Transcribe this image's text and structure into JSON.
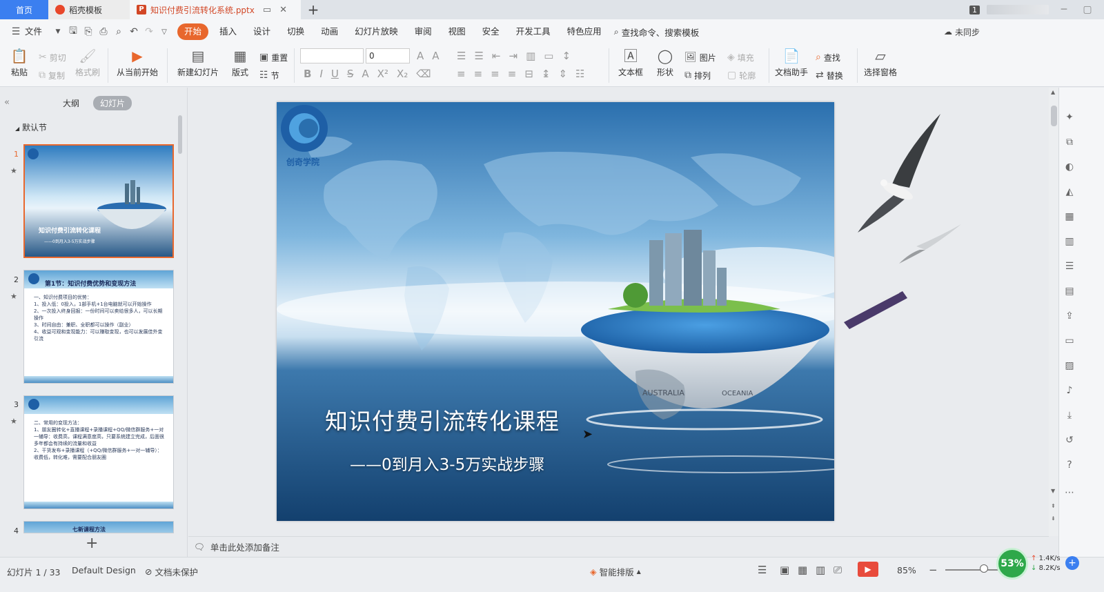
{
  "tabs": {
    "home": "首页",
    "template": "稻壳模板",
    "active_file": "知识付费引流转化系统.pptx",
    "page_badge": "1"
  },
  "menu": {
    "file": "文件",
    "items": [
      "开始",
      "插入",
      "设计",
      "切换",
      "动画",
      "幻灯片放映",
      "审阅",
      "视图",
      "安全",
      "开发工具",
      "特色应用"
    ],
    "search": "查找命令、搜索模板",
    "sync": "未同步"
  },
  "ribbon": {
    "paste": "粘贴",
    "cut": "剪切",
    "copy": "复制",
    "format_painter": "格式刷",
    "from_current": "从当前开始",
    "new_slide": "新建幻灯片",
    "layout": "版式",
    "reset": "重置",
    "section": "节",
    "font_size": "0",
    "text_box": "文本框",
    "shape": "形状",
    "picture": "图片",
    "arrange": "排列",
    "fill": "填充",
    "outline": "轮廓",
    "doc_assistant": "文档助手",
    "find": "查找",
    "replace": "替换",
    "selection_pane": "选择窗格"
  },
  "left_panel": {
    "tab_outline": "大纲",
    "tab_slides": "幻灯片",
    "section": "默认节",
    "slides": [
      {
        "num": "1",
        "title": "知识付费引流转化课程",
        "subtitle": "——0到月入3-5万实战步骤"
      },
      {
        "num": "2",
        "title": "第1节：知识付费优势和变现方法",
        "lines": [
          "一、知识付费项目的优势：",
          "1、投入低：0投入，1部手机+1台电脑就可以开始操作",
          "2、一次投入终身回报：一份时间可以卖给很多人，可以长期操作",
          "3、时间自由：兼职、全职都可以操作（副业）",
          "4、收益可观和变现能力：可以赚取变现，也可以发展佳外变引流"
        ]
      },
      {
        "num": "3",
        "lines": [
          "二、常用的变现方法：",
          "1、朋友圈转化+直播课程+录播课程+QQ/微信群服务+一对一辅导：收费高，课程满意度高，只要系统建立完成，后面很多年都会有持续的流量和收益",
          "2、干货发布+录播课程（+QQ/微信群服务+一对一辅导）：收费低，转化难，需要配合朋友圈"
        ]
      },
      {
        "num": "4",
        "title": "七新课程方法"
      }
    ]
  },
  "slide": {
    "logo_text": "创奇学院",
    "title": "知识付费引流转化课程",
    "subtitle": "——0到月入3-5万实战步骤",
    "map_label_1": "AUSTRALIA",
    "map_label_2": "OCEANIA"
  },
  "notes_placeholder": "单击此处添加备注",
  "status": {
    "slide_counter": "幻灯片 1 / 33",
    "design": "Default Design",
    "protection": "文档未保护",
    "smart_layout": "智能排版",
    "zoom": "85%",
    "perf": "53%",
    "net_up": "1.4K/s",
    "net_down": "8.2K/s"
  },
  "colors": {
    "accent": "#e8672d",
    "home_tab": "#3b7ff0",
    "ppt_red": "#d24726"
  }
}
